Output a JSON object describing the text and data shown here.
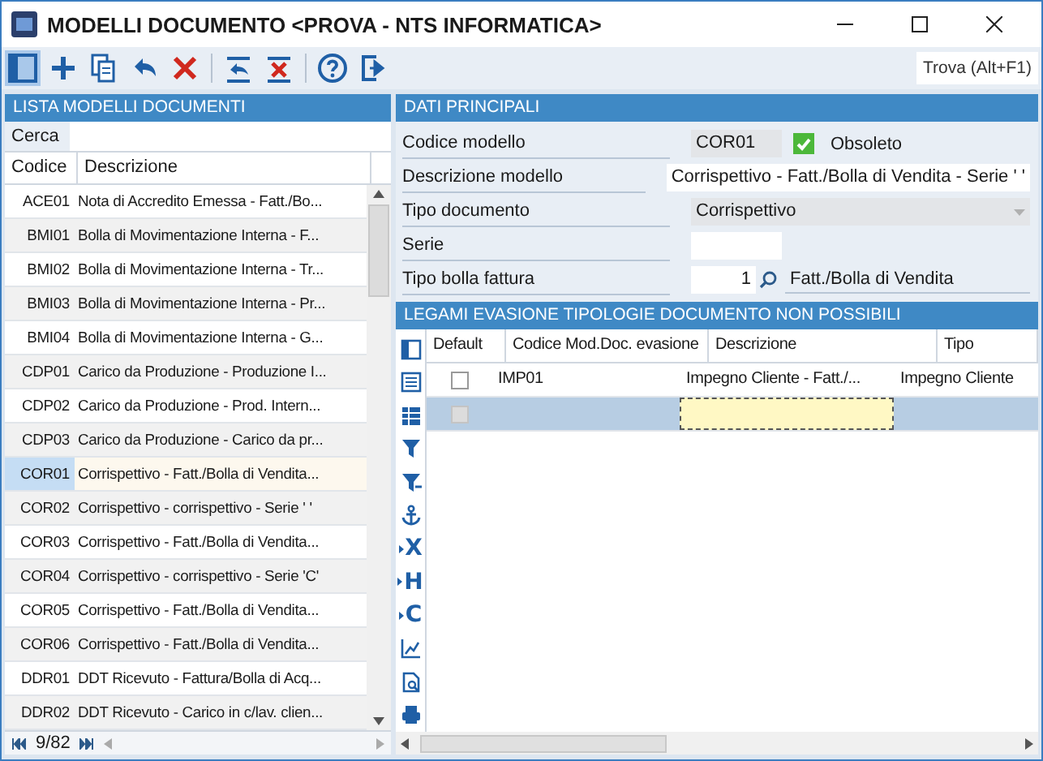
{
  "window": {
    "title": "MODELLI DOCUMENTO <PROVA - NTS INFORMATICA>"
  },
  "toolbar": {
    "buttons": [
      {
        "kind": "panel",
        "selected": true
      },
      {
        "kind": "plus",
        "selected": false
      },
      {
        "kind": "copy",
        "selected": false
      },
      {
        "kind": "undo",
        "selected": false
      },
      {
        "kind": "delete",
        "selected": false
      },
      {
        "kind": "separator"
      },
      {
        "kind": "restore",
        "selected": false
      },
      {
        "kind": "cancel",
        "selected": false
      },
      {
        "kind": "separator"
      },
      {
        "kind": "help",
        "selected": false
      },
      {
        "kind": "exit",
        "selected": false
      }
    ],
    "search_button": "Trova (Alt+F1)"
  },
  "list": {
    "title": "LISTA MODELLI DOCUMENTI",
    "search_label": "Cerca",
    "columns": [
      "Codice",
      "Descrizione"
    ],
    "rows": [
      {
        "code": "ACE01",
        "description": "Nota di Accredito Emessa - Fatt./Bo...",
        "selected": false
      },
      {
        "code": "BMI01",
        "description": "Bolla di Movimentazione Interna - F...",
        "selected": false
      },
      {
        "code": "BMI02",
        "description": "Bolla di Movimentazione Interna - Tr...",
        "selected": false
      },
      {
        "code": "BMI03",
        "description": "Bolla di Movimentazione Interna - Pr...",
        "selected": false
      },
      {
        "code": "BMI04",
        "description": "Bolla di Movimentazione Interna - G...",
        "selected": false
      },
      {
        "code": "CDP01",
        "description": "Carico da Produzione - Produzione I...",
        "selected": false
      },
      {
        "code": "CDP02",
        "description": "Carico da Produzione - Prod. Intern...",
        "selected": false
      },
      {
        "code": "CDP03",
        "description": "Carico da Produzione - Carico da pr...",
        "selected": false
      },
      {
        "code": "COR01",
        "description": "Corrispettivo - Fatt./Bolla di Vendita...",
        "selected": true
      },
      {
        "code": "COR02",
        "description": "Corrispettivo - corrispettivo - Serie ' '",
        "selected": false
      },
      {
        "code": "COR03",
        "description": "Corrispettivo - Fatt./Bolla di Vendita...",
        "selected": false
      },
      {
        "code": "COR04",
        "description": "Corrispettivo - corrispettivo - Serie 'C'",
        "selected": false
      },
      {
        "code": "COR05",
        "description": "Corrispettivo - Fatt./Bolla di Vendita...",
        "selected": false
      },
      {
        "code": "COR06",
        "description": "Corrispettivo - Fatt./Bolla di Vendita...",
        "selected": false
      },
      {
        "code": "DDR01",
        "description": "DDT Ricevuto - Fattura/Bolla di Acq...",
        "selected": false
      },
      {
        "code": "DDR02",
        "description": "DDT Ricevuto - Carico in c/lav. clien...",
        "selected": false
      }
    ],
    "pager": "9/82"
  },
  "details": {
    "title": "DATI PRINCIPALI",
    "fields": [
      {
        "kind": "code",
        "label": "Codice modello",
        "value": "COR01",
        "checkbox": {
          "label": "Obsoleto",
          "checked": true
        }
      },
      {
        "kind": "text",
        "label": "Descrizione modello",
        "value": "Corrispettivo - Fatt./Bolla di Vendita - Serie ' '"
      },
      {
        "kind": "combo",
        "label": "Tipo documento",
        "value": "Corrispettivo"
      },
      {
        "kind": "short",
        "label": "Serie"
      },
      {
        "kind": "lookup",
        "label": "Tipo bolla fattura",
        "value": "1",
        "description": "Fatt./Bolla di Vendita"
      }
    ]
  },
  "links": {
    "title": "LEGAMI EVASIONE TIPOLOGIE DOCUMENTO NON POSSIBILI",
    "tools": [
      {
        "kind": "columns"
      },
      {
        "kind": "list"
      },
      {
        "kind": "grid"
      },
      {
        "kind": "filter"
      },
      {
        "kind": "filter-clear"
      },
      {
        "kind": "anchor"
      },
      {
        "kind": "letter",
        "label": "X"
      },
      {
        "kind": "letter",
        "label": "H"
      },
      {
        "kind": "letter",
        "label": "C"
      },
      {
        "kind": "chart"
      },
      {
        "kind": "preview"
      },
      {
        "kind": "print"
      }
    ],
    "columns": [
      "Default",
      "Codice Mod.Doc. evasione",
      "Descrizione",
      "Tipo"
    ],
    "rows": [
      {
        "default": false,
        "disabled": false,
        "code": "IMP01",
        "description": "Impegno Cliente - Fatt./...",
        "type": "Impegno Cliente",
        "selected": false,
        "focused": false
      },
      {
        "default": false,
        "disabled": true,
        "selected": true,
        "focused": true
      }
    ]
  }
}
